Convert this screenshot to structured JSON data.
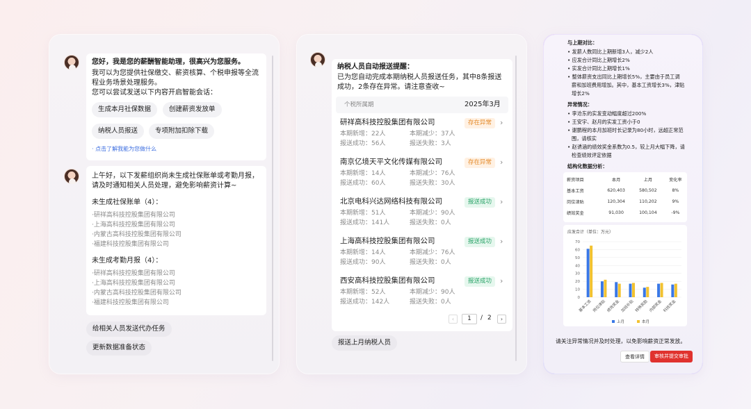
{
  "panel1": {
    "greet_title": "您好，我是您的薪酬智能助理，很高兴为您服务。",
    "greet_line1": "我可以为您提供社保缴交、薪资核算、个税申报等全流",
    "greet_line2": "程业务场景处理服务。",
    "greet_line3": "您可以尝试发送以下内容开启智能会话：",
    "chips": [
      "生成本月社保数据",
      "创建薪资发放单",
      "纳税人员报送",
      "专项附加扣除下载"
    ],
    "help_link": "点击了解我能为您做什么",
    "msg2_line1": "上午好，以下发薪组织尚未生成社保账单或考勤月报，",
    "msg2_line2": "请及时通知相关人员处理，避免影响薪资计算~",
    "section1_title": "未生成社保账单（4）：",
    "section1_items": [
      "·研祥高科技控股集团有限公司",
      "·上海高科技控股集团有限公司",
      "·内蒙古高科技控股集团有限公司",
      "·福建科技控股集团有限公司"
    ],
    "section2_title": "未生成考勤月报（4）：",
    "section2_items": [
      "·研祥高科技控股集团有限公司",
      "·上海高科技控股集团有限公司",
      "·内蒙古高科技控股集团有限公司",
      "·福建科技控股集团有限公司"
    ],
    "action1": "给相关人员发送代办任务",
    "action2": "更新数据准备状态"
  },
  "panel2": {
    "title": "纳税人员自动报送提醒：",
    "desc1": "已为您自动完成本期纳税人员报送任务，其中8条报送",
    "desc2": "成功，2条存在异常。请注意查收~",
    "period_label": "个税所属期",
    "period_value": "2025年3月",
    "companies": [
      {
        "name": "研祥高科技控股集团有限公司",
        "new": "本期新增：22人",
        "reduce": "本期减少：37人",
        "ok": "报送成功：56人",
        "fail": "报送失败：3人",
        "status": "存在异常",
        "kind": "warn"
      },
      {
        "name": "南京亿境天平文化传媒有限公司",
        "new": "本期新增：14人",
        "reduce": "本期减少：76人",
        "ok": "报送成功：60人",
        "fail": "报送失败：30人",
        "status": "存在异常",
        "kind": "warn"
      },
      {
        "name": "北京电科兴达网络科技有限公司",
        "new": "本期新增：51人",
        "reduce": "本期减少：90人",
        "ok": "报送成功：141人",
        "fail": "报送失败：0人",
        "status": "报送成功",
        "kind": "ok"
      },
      {
        "name": "上海高科技控股集团有限公司",
        "new": "本期新增：14人",
        "reduce": "本期减少：76人",
        "ok": "报送成功：90人",
        "fail": "报送失败：0人",
        "status": "报送成功",
        "kind": "ok"
      },
      {
        "name": "西安高科技控股集团有限公司",
        "new": "本期新增：52人",
        "reduce": "本期减少：90人",
        "ok": "报送成功：142人",
        "fail": "报送失败：0人",
        "status": "报送成功",
        "kind": "ok"
      }
    ],
    "page_current": "1",
    "page_sep": "/",
    "page_total": "2",
    "action": "报送上月纳税人员"
  },
  "panel3": {
    "compare_title": "与上期对比：",
    "compare_items": [
      "发薪人数同比上期新增3人，减少2人",
      "应发合计同比上期增长2%",
      "实发合计同比上期增长1%",
      "整体薪资支出同比上期增长5%，主要由于员工调",
      "薪和加班费用增加。其中，基本工资增长3%，津贴",
      "增长2%"
    ],
    "anomaly_title": "异常情况：",
    "anomaly_items": [
      "李沧东的实发变动幅度超过200%",
      "王安宇、赵月的实发工资小于0",
      "谢鹏程的本月加班时长记录为80小时，远超正常范",
      "围，请核实",
      "赵诱涵的绩效奖金系数为0.5，较上月大幅下降，请",
      "检查绩效评定依据"
    ],
    "struct_title": "结构化数据分析：",
    "table": {
      "headers": [
        "薪资项目",
        "本月",
        "上月",
        "变化率"
      ],
      "rows": [
        [
          "基本工资",
          "620,403",
          "580,502",
          "8%"
        ],
        [
          "岗位津贴",
          "120,304",
          "110,202",
          "9%"
        ],
        [
          "绩效奖金",
          "91,030",
          "100,104",
          "-9%"
        ]
      ]
    },
    "footer_text": "请关注异常情况并及时处理，以免影响薪资正常发放。",
    "btn_detail": "查看详情",
    "btn_submit": "审核并提交审批"
  },
  "chart_data": {
    "type": "bar",
    "title": "应发合计（单位：万元）",
    "categories": [
      "基本工资",
      "岗位津贴",
      "绩效奖金",
      "加班补贴",
      "特殊奖励",
      "内部奖金",
      "科技奖金"
    ],
    "series": [
      {
        "name": "上月",
        "values": [
          61,
          20,
          19,
          17,
          12,
          17,
          16
        ],
        "color": "#3a78e6"
      },
      {
        "name": "本月",
        "values": [
          65,
          22,
          17,
          18,
          13,
          18,
          17
        ],
        "color": "#f2c230"
      }
    ],
    "ylim": [
      0,
      70
    ],
    "yticks": [
      0,
      10,
      20,
      30,
      40,
      50,
      60,
      70
    ]
  }
}
